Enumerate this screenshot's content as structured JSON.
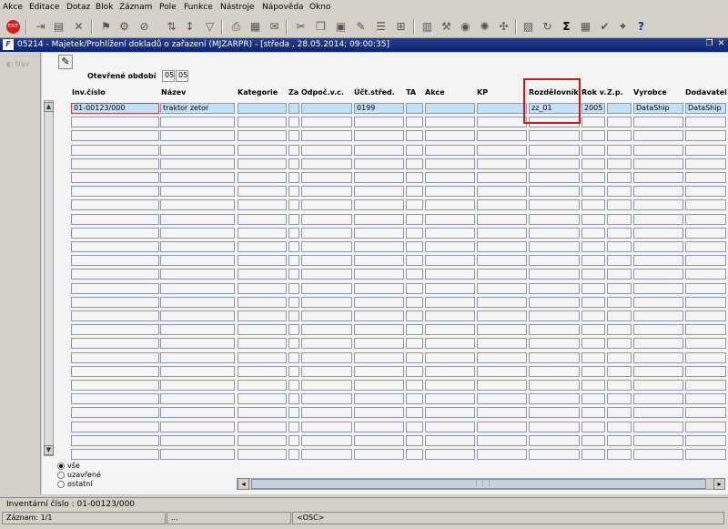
{
  "menu": [
    "Akce",
    "Editace",
    "Dotaz",
    "Blok",
    "Záznam",
    "Pole",
    "Funkce",
    "Nástroje",
    "Nápověda",
    "Okno"
  ],
  "window": {
    "title": "05214 - Majetek/Prohlížení dokladů o zařazení (MJZARPR) - [středa , 28.05.2014; 09:00:35]"
  },
  "nav": {
    "label": "Nav"
  },
  "period": {
    "label": "Otevřené období",
    "month": "05",
    "year": "05"
  },
  "columns": [
    "Inv.číslo",
    "Název",
    "Kategorie",
    "Za",
    "Odpoč.v.c.",
    "Účt.střed.",
    "TA",
    "Akce",
    "KP",
    "Rozdělovník",
    "Rok v.",
    "Z.p.",
    "Vyrobce",
    "Dodavatel"
  ],
  "rows": [
    {
      "inv": "01-00123/000",
      "nazev": "traktor zetor",
      "ucet": "0199",
      "rozdelovnik": "zz_01",
      "rok": "2005",
      "vyrobce": "DataShip",
      "dodavatel": "DataShip"
    }
  ],
  "filter": {
    "options": [
      "vše",
      "uzavřené",
      "ostatní"
    ],
    "selected": "vše"
  },
  "hint": "Inventární číslo : 01-00123/000",
  "status": {
    "record": "Záznam: 1/1",
    "mode": "...",
    "osc": "<OSC>"
  },
  "colors": {
    "titlebar": "#0a2470",
    "selected_row": "#c4e0f4",
    "highlight_box": "#e01010"
  }
}
